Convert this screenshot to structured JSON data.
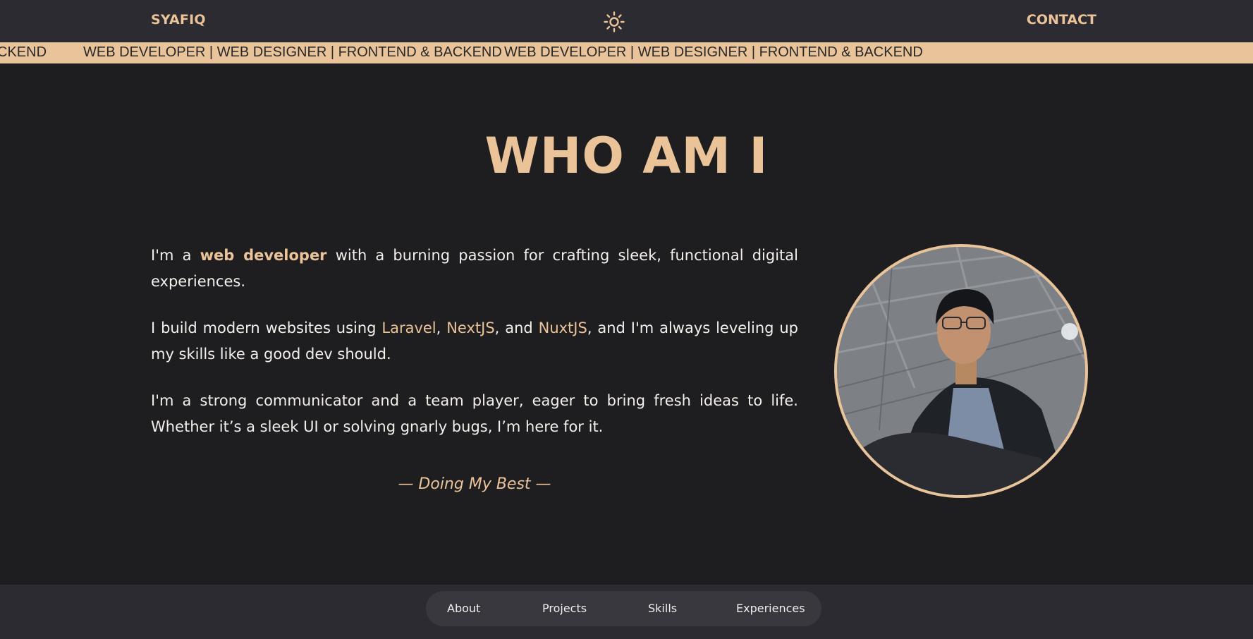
{
  "header": {
    "brand": "SYAFIQ",
    "theme_toggle_icon": "sun-icon",
    "contact_label": "CONTACT"
  },
  "marquee": {
    "items": [
      "CKEND",
      "WEB DEVELOPER | WEB DESIGNER | FRONTEND & BACKEND",
      "WEB DEVELOPER | WEB DESIGNER | FRONTEND & BACKEND"
    ]
  },
  "about": {
    "title": "WHO AM I",
    "p1": {
      "pre": "I'm a ",
      "highlight": "web developer",
      "post": " with a burning passion for crafting sleek, functional digital experiences."
    },
    "p2": {
      "pre": "I build modern websites using ",
      "tech1": "Laravel",
      "sep1": ", ",
      "tech2": "NextJS",
      "sep2": ", and ",
      "tech3": "NuxtJS",
      "post": ", and I'm always leveling up my skills like a good dev should."
    },
    "p3": "I'm a strong communicator and a team player, eager to bring fresh ideas to life. Whether it’s a sleek UI or solving gnarly bugs, I’m here for it.",
    "motto": "— Doing My Best —"
  },
  "footer_nav": {
    "items": [
      "About",
      "Projects",
      "Skills",
      "Experiences"
    ]
  },
  "colors": {
    "accent": "#ebc398",
    "background": "#1e1d20",
    "bar": "#2c2b31"
  }
}
